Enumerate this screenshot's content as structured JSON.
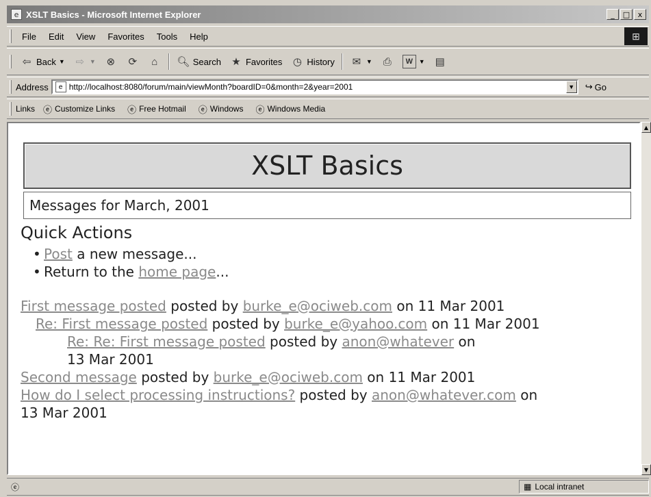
{
  "window": {
    "title": "XSLT Basics - Microsoft Internet Explorer",
    "controls": [
      "_",
      "□",
      "x"
    ]
  },
  "menu": [
    "File",
    "Edit",
    "View",
    "Favorites",
    "Tools",
    "Help"
  ],
  "toolbar": {
    "back": "Back",
    "search": "Search",
    "favorites": "Favorites",
    "history": "History"
  },
  "address": {
    "label": "Address",
    "url": "http://localhost:8080/forum/main/viewMonth?boardID=0&month=2&year=2001",
    "go": "Go"
  },
  "links": {
    "label": "Links",
    "items": [
      "Customize Links",
      "Free Hotmail",
      "Windows",
      "Windows Media"
    ]
  },
  "page": {
    "title": "XSLT Basics",
    "month_header": "Messages for March, 2001",
    "quick_actions_title": "Quick Actions",
    "actions": [
      {
        "link": "Post",
        "text": " a new message..."
      },
      {
        "prefix": "Return to the ",
        "link": "home page",
        "suffix": "..."
      }
    ],
    "messages": [
      {
        "subject": "First message posted",
        "by_text": " posted by ",
        "author": "burke_e@ociweb.com",
        "date_text": " on 11 Mar 2001"
      },
      {
        "subject": "Re: First message posted",
        "by_text": " posted by ",
        "author": "burke_e@yahoo.com",
        "date_text": " on 11 Mar 2001"
      },
      {
        "subject": "Re: Re: First message posted",
        "by_text": " posted by ",
        "author": "anon@whatever",
        "date_text": " on",
        "date_line2": "13 Mar 2001"
      },
      {
        "subject": "Second message",
        "by_text": " posted by ",
        "author": "burke_e@ociweb.com",
        "date_text": " on 11 Mar 2001"
      },
      {
        "subject": "How do I select processing instructions?",
        "by_text": " posted by ",
        "author": "anon@whatever.com",
        "date_text": " on",
        "date_line2": "13 Mar 2001"
      }
    ]
  },
  "status": {
    "zone": "Local intranet"
  }
}
